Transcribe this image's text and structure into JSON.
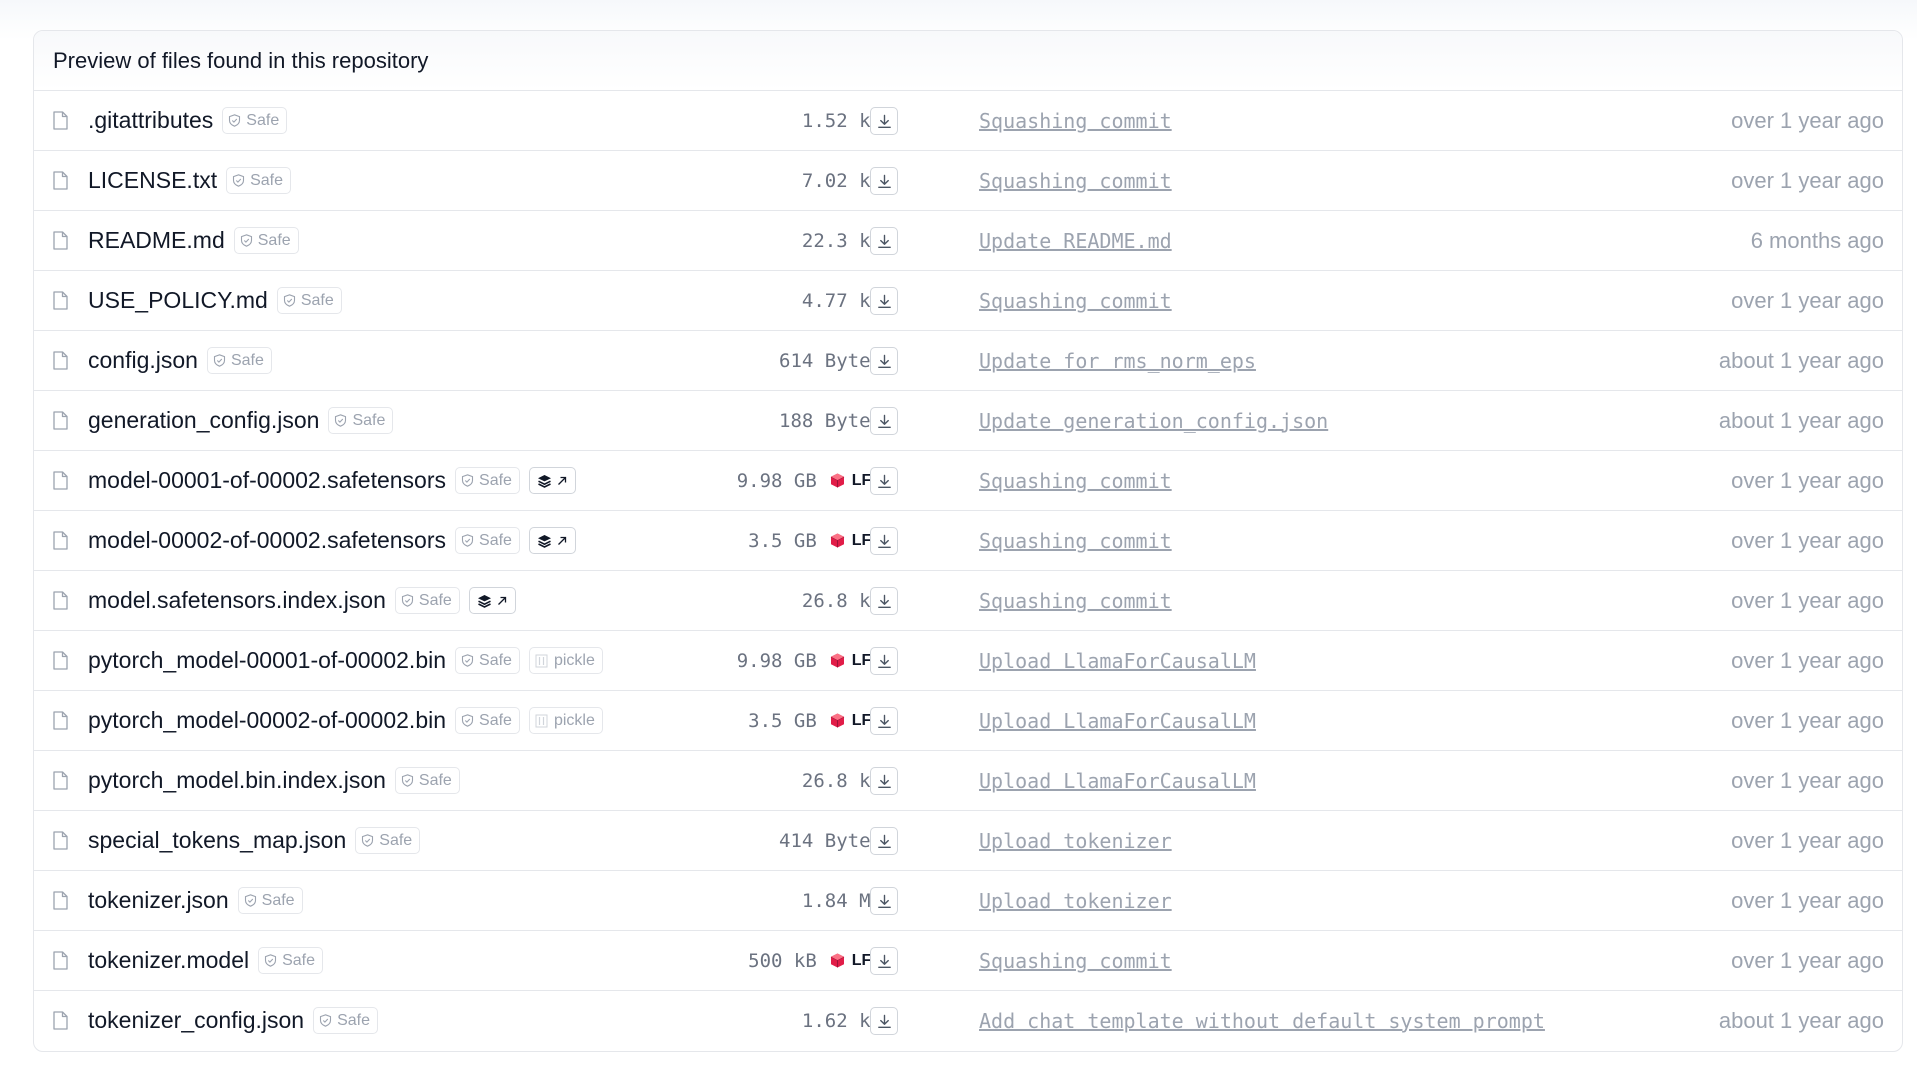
{
  "header": {
    "title": "Preview of files found in this repository"
  },
  "badges": {
    "safe": "Safe",
    "pickle": "pickle",
    "lfs": "LFS"
  },
  "colors": {
    "lfs_accent": "#e11d48",
    "muted_text": "#9ca3af",
    "border": "#e5e7eb"
  },
  "files": [
    {
      "name": ".gitattributes",
      "size": "1.52 kB",
      "lfs": false,
      "viewer": false,
      "pickle": false,
      "commit": "Squashing commit",
      "time": "over 1 year ago"
    },
    {
      "name": "LICENSE.txt",
      "size": "7.02 kB",
      "lfs": false,
      "viewer": false,
      "pickle": false,
      "commit": "Squashing commit",
      "time": "over 1 year ago"
    },
    {
      "name": "README.md",
      "size": "22.3 kB",
      "lfs": false,
      "viewer": false,
      "pickle": false,
      "commit": "Update README.md",
      "time": "6 months ago"
    },
    {
      "name": "USE_POLICY.md",
      "size": "4.77 kB",
      "lfs": false,
      "viewer": false,
      "pickle": false,
      "commit": "Squashing commit",
      "time": "over 1 year ago"
    },
    {
      "name": "config.json",
      "size": "614 Bytes",
      "lfs": false,
      "viewer": false,
      "pickle": false,
      "commit": "Update for rms_norm_eps",
      "time": "about 1 year ago"
    },
    {
      "name": "generation_config.json",
      "size": "188 Bytes",
      "lfs": false,
      "viewer": false,
      "pickle": false,
      "commit": "Update generation_config.json",
      "time": "about 1 year ago"
    },
    {
      "name": "model-00001-of-00002.safetensors",
      "size": "9.98 GB",
      "lfs": true,
      "viewer": true,
      "pickle": false,
      "commit": "Squashing commit",
      "time": "over 1 year ago"
    },
    {
      "name": "model-00002-of-00002.safetensors",
      "size": "3.5 GB",
      "lfs": true,
      "viewer": true,
      "pickle": false,
      "commit": "Squashing commit",
      "time": "over 1 year ago"
    },
    {
      "name": "model.safetensors.index.json",
      "size": "26.8 kB",
      "lfs": false,
      "viewer": true,
      "pickle": false,
      "commit": "Squashing commit",
      "time": "over 1 year ago"
    },
    {
      "name": "pytorch_model-00001-of-00002.bin",
      "size": "9.98 GB",
      "lfs": true,
      "viewer": false,
      "pickle": true,
      "commit": "Upload LlamaForCausalLM",
      "time": "over 1 year ago"
    },
    {
      "name": "pytorch_model-00002-of-00002.bin",
      "size": "3.5 GB",
      "lfs": true,
      "viewer": false,
      "pickle": true,
      "commit": "Upload LlamaForCausalLM",
      "time": "over 1 year ago"
    },
    {
      "name": "pytorch_model.bin.index.json",
      "size": "26.8 kB",
      "lfs": false,
      "viewer": false,
      "pickle": false,
      "commit": "Upload LlamaForCausalLM",
      "time": "over 1 year ago"
    },
    {
      "name": "special_tokens_map.json",
      "size": "414 Bytes",
      "lfs": false,
      "viewer": false,
      "pickle": false,
      "commit": "Upload tokenizer",
      "time": "over 1 year ago"
    },
    {
      "name": "tokenizer.json",
      "size": "1.84 MB",
      "lfs": false,
      "viewer": false,
      "pickle": false,
      "commit": "Upload tokenizer",
      "time": "over 1 year ago"
    },
    {
      "name": "tokenizer.model",
      "size": "500 kB",
      "lfs": true,
      "viewer": false,
      "pickle": false,
      "commit": "Squashing commit",
      "time": "over 1 year ago"
    },
    {
      "name": "tokenizer_config.json",
      "size": "1.62 kB",
      "lfs": false,
      "viewer": false,
      "pickle": false,
      "commit": "Add chat template without default system prompt",
      "time": "about 1 year ago"
    }
  ]
}
